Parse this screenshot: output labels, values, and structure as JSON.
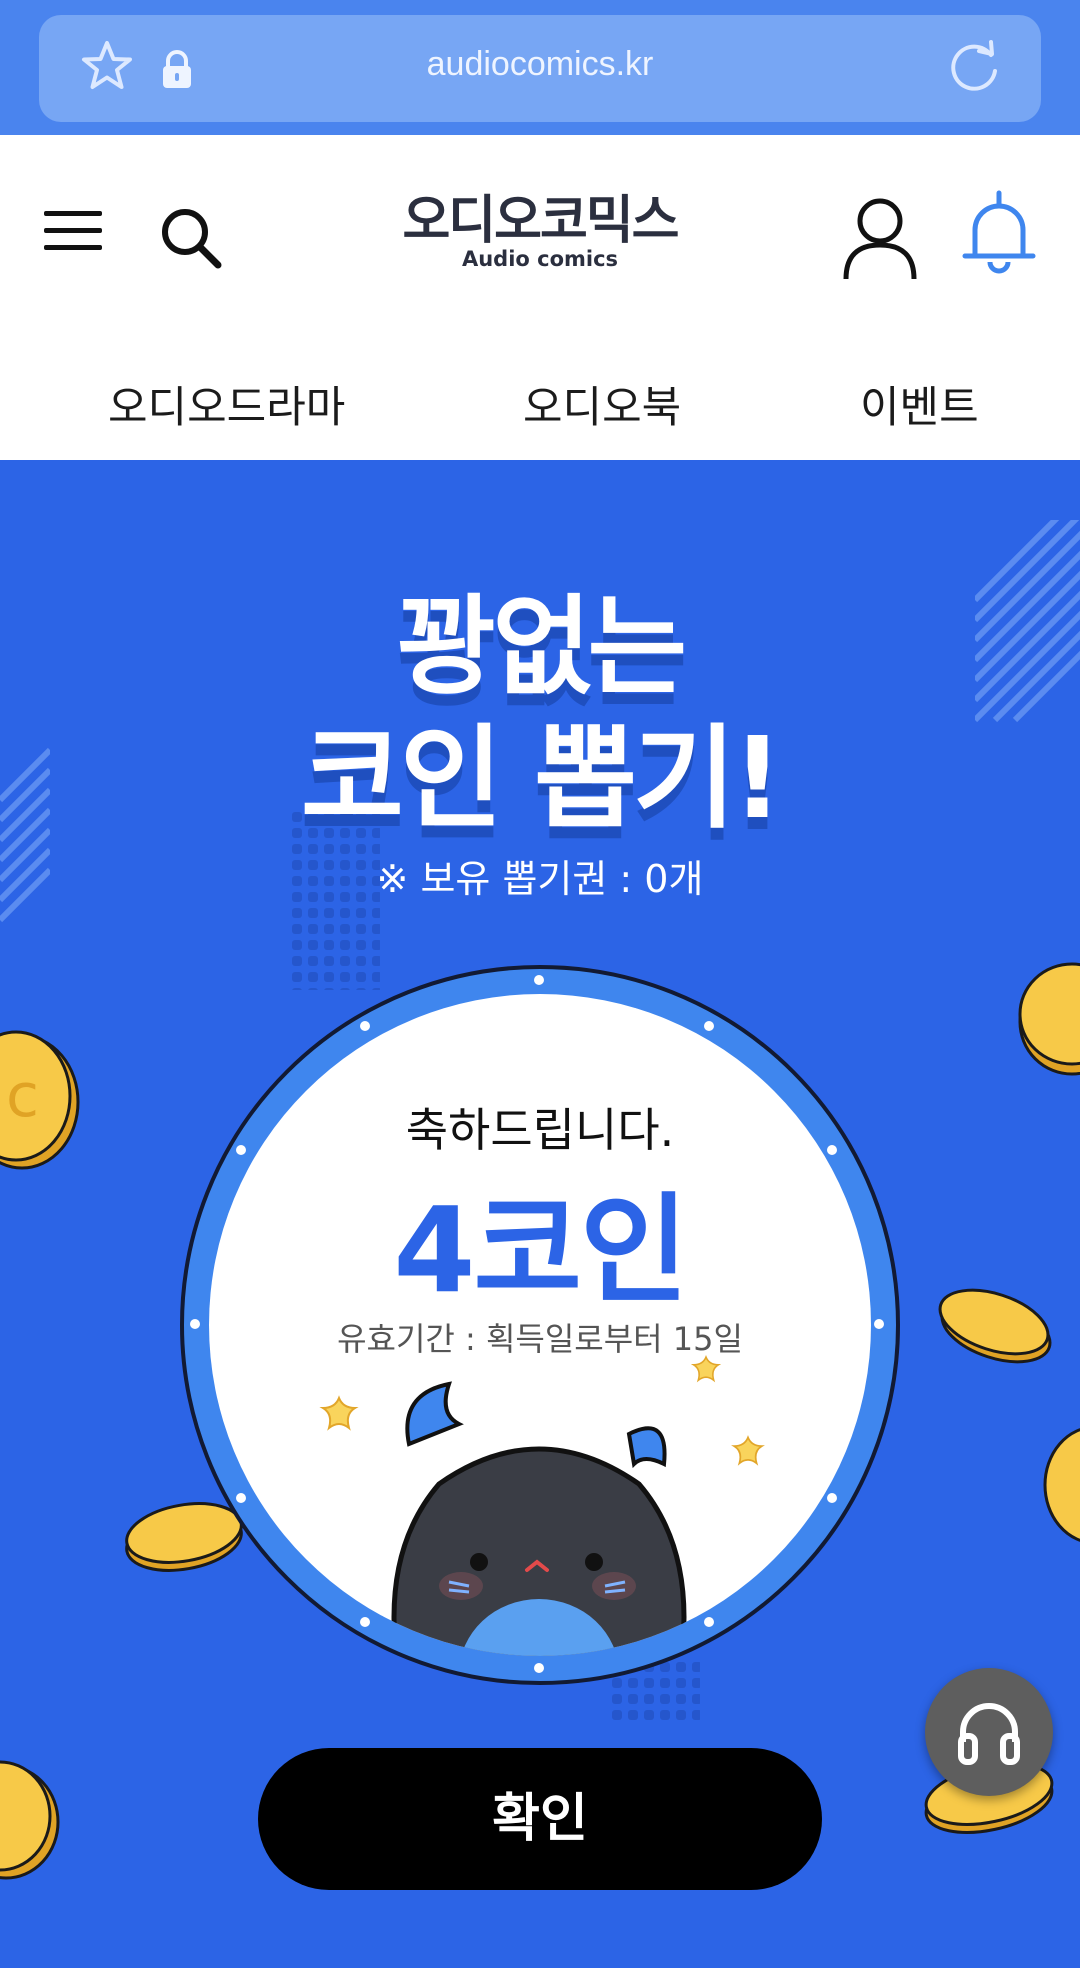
{
  "browser": {
    "url": "audiocomics.kr"
  },
  "header": {
    "logo_ko": "오디오코믹스",
    "logo_en": "Audio comics",
    "nav": [
      "오디오드라마",
      "오디오북",
      "이벤트"
    ]
  },
  "banner": {
    "title_line1": "꽝없는",
    "title_line2": "코인 뽑기!",
    "ticket_text": "※ 보유 뽑기권 : 0개",
    "congrats": "축하드립니다.",
    "reward": "4코인",
    "validity": "유효기간 : 획득일로부터 15일",
    "confirm_label": "확인"
  },
  "colors": {
    "background": "#2c64e6",
    "accent": "#2c64e6",
    "button": "#000000",
    "coin": "#f7c948"
  },
  "icons": [
    "star-icon",
    "lock-icon",
    "reload-icon",
    "menu-icon",
    "search-icon",
    "user-icon",
    "bell-icon",
    "headphones-icon"
  ]
}
